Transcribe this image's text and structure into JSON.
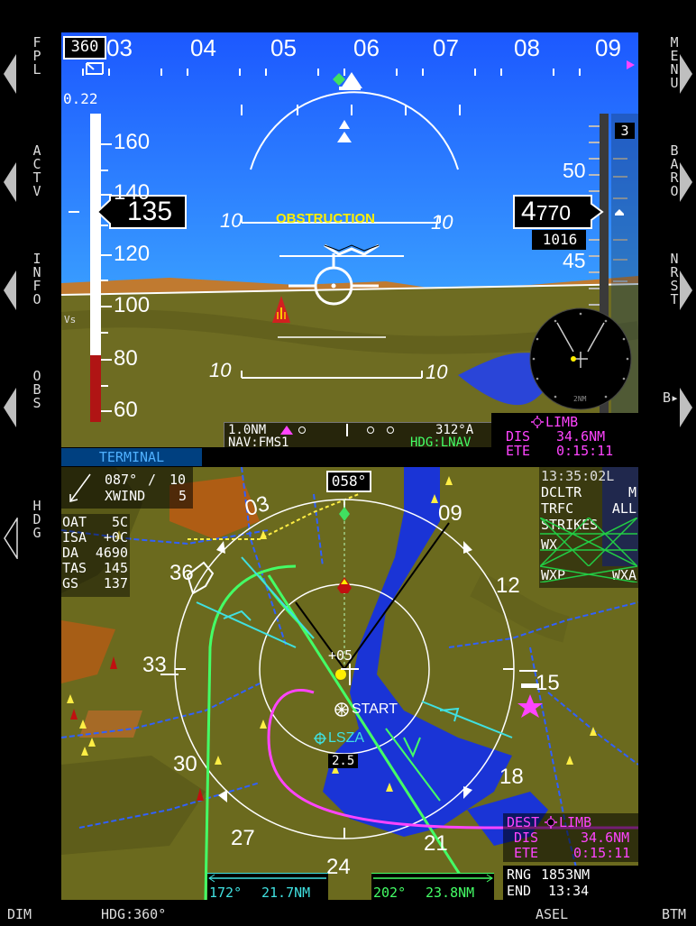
{
  "softkeys": {
    "left": [
      {
        "label": "FPL",
        "hollow": false
      },
      {
        "label": "ACTV",
        "hollow": false
      },
      {
        "label": "INFO",
        "hollow": false
      },
      {
        "label": "OBS",
        "hollow": false
      },
      {
        "label": "HDG",
        "hollow": true
      }
    ],
    "right": [
      {
        "label": "MENU"
      },
      {
        "label": "BARO"
      },
      {
        "label": "NRST"
      },
      {
        "label": "B▸"
      }
    ],
    "bottom": {
      "dim": "DIM",
      "hdg": "HDG:360°",
      "asel": "ASEL",
      "btm": "BTM"
    }
  },
  "pfd": {
    "heading_box": "360",
    "heading_ticks": [
      "03",
      "04",
      "05",
      "06",
      "07",
      "08",
      "09"
    ],
    "mach": "0.22",
    "airspeed": {
      "current": "135",
      "ticks": [
        "160",
        "140",
        "120",
        "100",
        "80",
        "60"
      ],
      "vs_label": "Vs"
    },
    "altitude": {
      "current_big": "4",
      "current_small": "770",
      "baro": "1016",
      "ticks": [
        "50",
        "45"
      ],
      "vsi_top": "3"
    },
    "pitch_labels": [
      "10",
      "10",
      "10",
      "10"
    ],
    "alert": "OBSTRUCTION",
    "nav": {
      "range": "1.0NM",
      "course": "312°A",
      "source": "NAV:FMS1",
      "mode": "HDG:LNAV"
    },
    "waypoint_box": {
      "name": "LIMB",
      "dis_label": "DIS",
      "dis": "34.6NM",
      "ete_label": "ETE",
      "ete": "0:15:11"
    },
    "inset_range": "2NM",
    "colors": {
      "sky": "#1a73ff",
      "ground": "#6c6a1c",
      "magenta": "#ff44ff",
      "cyan": "#40e0e0",
      "green": "#44ff66"
    }
  },
  "mfd": {
    "tab": "TERMINAL",
    "heading": "058°",
    "wind": {
      "dir": "087°",
      "speed": "10",
      "xwind_label": "XWIND",
      "xwind": "5"
    },
    "air": [
      {
        "k": "OAT",
        "v": "5C"
      },
      {
        "k": "ISA",
        "v": "+0C"
      },
      {
        "k": "DA",
        "v": "4690"
      },
      {
        "k": "TAS",
        "v": "145"
      },
      {
        "k": "GS",
        "v": "137"
      }
    ],
    "status": [
      {
        "k": "13:35:02L",
        "v": ""
      },
      {
        "k": "DCLTR",
        "v": "M"
      },
      {
        "k": "TRFC",
        "v": "ALL"
      },
      {
        "k": "STRIKES",
        "v": ""
      },
      {
        "k": "WX",
        "v": ""
      },
      {
        "k": "WXP",
        "v": "WXA"
      }
    ],
    "compass_labels": [
      "03",
      "09",
      "12",
      "15",
      "18",
      "21",
      "24",
      "27",
      "30",
      "33",
      "36"
    ],
    "start_label": "START",
    "airport": "LSZA",
    "range_ring": "2.5",
    "alt_tag": "+05",
    "dest": {
      "label": "DEST",
      "name": "LIMB",
      "dis_label": "DIS",
      "dis": "34.6NM",
      "ete_label": "ETE",
      "ete": "0:15:11"
    },
    "rng": {
      "label": "RNG",
      "value": "1853NM"
    },
    "end": {
      "label": "END",
      "value": "13:34"
    },
    "bearing1": {
      "brg": "172°",
      "dist": "21.7NM"
    },
    "bearing2": {
      "brg": "202°",
      "dist": "23.8NM"
    }
  }
}
